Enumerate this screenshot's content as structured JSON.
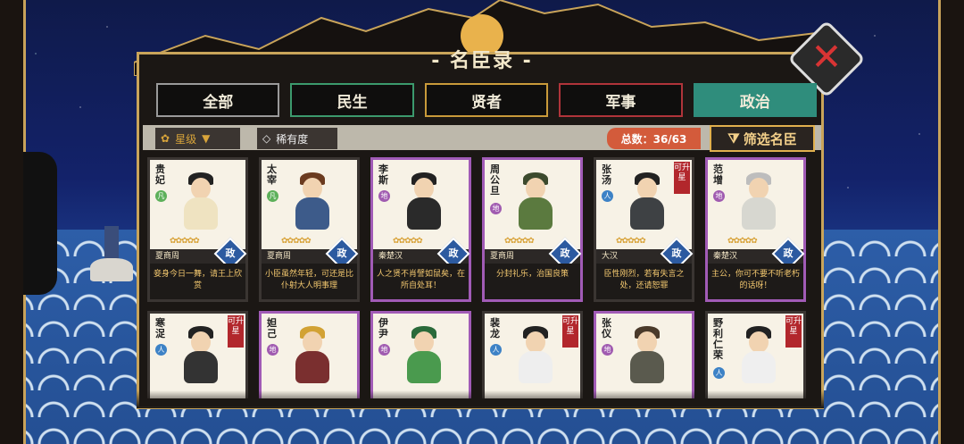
{
  "title": "名臣录",
  "tabs": [
    "全部",
    "民生",
    "贤者",
    "军事",
    "政治"
  ],
  "filters": {
    "star_label": "星级",
    "rarity_label": "稀有度",
    "total": "总数：36/63",
    "filter_button": "筛选名臣"
  },
  "cards_row1": [
    {
      "name": "贵妃",
      "type": "凡",
      "dynasty": "夏商周",
      "tag": "政",
      "desc": "妾身今日一舞，请王上欣赏",
      "upgrade": ""
    },
    {
      "name": "太宰",
      "type": "凡",
      "dynasty": "夏商周",
      "tag": "政",
      "desc": "小臣虽然年轻，可还是比仆射大人明事理",
      "upgrade": ""
    },
    {
      "name": "李斯",
      "type": "地",
      "dynasty": "秦楚汉",
      "tag": "政",
      "desc": "人之贤不肖譬如鼠矣，在所自处耳！",
      "upgrade": ""
    },
    {
      "name": "周公旦",
      "type": "地",
      "dynasty": "夏商周",
      "tag": "政",
      "desc": "分封礼乐，治国良策",
      "upgrade": ""
    },
    {
      "name": "张汤",
      "type": "人",
      "dynasty": "大汉",
      "tag": "政",
      "desc": "臣性刚烈，若有失言之处，还请恕罪",
      "upgrade": "可升星"
    },
    {
      "name": "范增",
      "type": "地",
      "dynasty": "秦楚汉",
      "tag": "政",
      "desc": "主公，你可不要不听老朽的话呀！",
      "upgrade": ""
    }
  ],
  "cards_row2": [
    {
      "name": "寒浞",
      "type": "人",
      "upgrade": "可升星"
    },
    {
      "name": "妲己",
      "type": "地",
      "upgrade": ""
    },
    {
      "name": "伊尹",
      "type": "地",
      "upgrade": ""
    },
    {
      "name": "裴龙",
      "type": "人",
      "upgrade": "可升星"
    },
    {
      "name": "张仪",
      "type": "地",
      "upgrade": ""
    },
    {
      "name": "野利仁荣",
      "type": "人",
      "upgrade": "可升星"
    }
  ]
}
